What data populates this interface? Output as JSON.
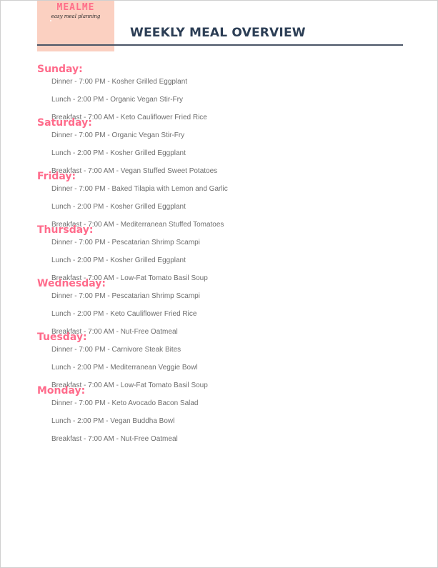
{
  "logo": {
    "name": "MEALME",
    "tagline": "easy meal planning"
  },
  "title": "WEEKLY MEAL OVERVIEW",
  "days": [
    {
      "name": "Sunday:",
      "meals": [
        "Dinner - 7:00 PM - Kosher Grilled Eggplant",
        "Lunch - 2:00 PM - Organic Vegan Stir-Fry",
        "Breakfast - 7:00 AM - Keto Cauliflower Fried Rice"
      ]
    },
    {
      "name": "Saturday:",
      "meals": [
        "Dinner - 7:00 PM - Organic Vegan Stir-Fry",
        "Lunch - 2:00 PM - Kosher Grilled Eggplant",
        "Breakfast - 7:00 AM - Vegan Stuffed Sweet Potatoes"
      ]
    },
    {
      "name": "Friday:",
      "meals": [
        "Dinner - 7:00 PM - Baked Tilapia with Lemon and Garlic",
        "Lunch - 2:00 PM - Kosher Grilled Eggplant",
        "Breakfast - 7:00 AM - Mediterranean Stuffed Tomatoes"
      ]
    },
    {
      "name": "Thursday:",
      "meals": [
        "Dinner - 7:00 PM - Pescatarian Shrimp Scampi",
        "Lunch - 2:00 PM - Kosher Grilled Eggplant",
        "Breakfast - 7:00 AM - Low-Fat Tomato Basil Soup"
      ]
    },
    {
      "name": "Wednesday:",
      "meals": [
        "Dinner - 7:00 PM - Pescatarian Shrimp Scampi",
        "Lunch - 2:00 PM - Keto Cauliflower Fried Rice",
        "Breakfast - 7:00 AM - Nut-Free Oatmeal"
      ]
    },
    {
      "name": "Tuesday:",
      "meals": [
        "Dinner - 7:00 PM - Carnivore Steak Bites",
        "Lunch - 2:00 PM - Mediterranean Veggie Bowl",
        "Breakfast - 7:00 AM - Low-Fat Tomato Basil Soup"
      ]
    },
    {
      "name": "Monday:",
      "meals": [
        "Dinner - 7:00 PM - Keto Avocado Bacon Salad",
        "Lunch - 2:00 PM - Vegan Buddha Bowl",
        "Breakfast - 7:00 AM - Nut-Free Oatmeal"
      ]
    }
  ],
  "colors": {
    "accent_pink": "#ff6b8b",
    "logo_background": "#fbd0c1",
    "title_navy": "#2c3e55",
    "meal_text_gray": "#6e6e6e"
  }
}
